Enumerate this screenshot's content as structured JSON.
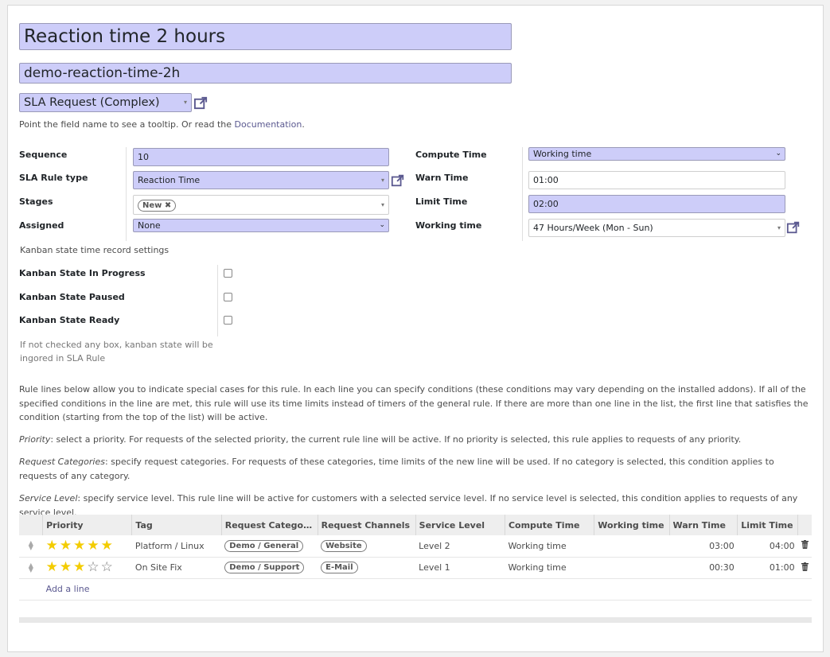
{
  "form": {
    "name": "Reaction time 2 hours",
    "code": "demo-reaction-time-2h",
    "sla_type": "SLA Request (Complex)",
    "hint_text": "Point the field name to see a tooltip. Or read the ",
    "hint_link": "Documentation",
    "hint_end": "."
  },
  "left": {
    "sequence_label": "Sequence",
    "sequence_value": "10",
    "rule_type_label": "SLA Rule type",
    "rule_type_value": "Reaction Time",
    "stages_label": "Stages",
    "stage_tag": "New",
    "assigned_label": "Assigned",
    "assigned_value": "None"
  },
  "right": {
    "compute_label": "Compute Time",
    "compute_value": "Working time",
    "warn_label": "Warn Time",
    "warn_value": "01:00",
    "limit_label": "Limit Time",
    "limit_value": "02:00",
    "working_label": "Working time",
    "working_value": "47 Hours/Week (Mon - Sun)"
  },
  "kanban": {
    "section_title": "Kanban state time record settings",
    "in_progress_label": "Kanban State In Progress",
    "paused_label": "Kanban State Paused",
    "ready_label": "Kanban State Ready",
    "note_line1": "If not checked any box, kanban state will be",
    "note_line2": "ingored in SLA Rule",
    "in_progress_checked": false,
    "paused_checked": false,
    "ready_checked": false
  },
  "help": {
    "p1": "Rule lines below allow you to indicate special cases for this rule. In each line you can specify conditions (these conditions may vary depending on the installed addons). If all of the specified conditions in the line are met, this rule will use its time limits instead of timers of the general rule. If there are more than one line in the list, the first line that satisfies the condition (starting from the top of the list) will be active.",
    "p2_term": "Priority",
    "p2_text": ": select a priority. For requests of the selected priority, the current rule line will be active. If no priority is selected, this rule applies to requests of any priority.",
    "p3_term": "Request Categories",
    "p3_text": ": specify request categories. For requests of these categories, time limits of the new line will be used. If no category is selected, this condition applies to requests of any category.",
    "p4_term": "Service Level",
    "p4_text": ": specify service level. This rule line will be active for customers with a selected service level. If no service level is selected, this condition applies to requests of any service level."
  },
  "table": {
    "headers": [
      "Priority",
      "Tag",
      "Request Catego…",
      "Request Channels",
      "Service Level",
      "Compute Time",
      "Working time",
      "Warn Time",
      "Limit Time"
    ],
    "rows": [
      {
        "priority": 5,
        "tag": "Platform / Linux",
        "category": "Demo / General",
        "channel": "Website",
        "service_level": "Level 2",
        "compute_time": "Working time",
        "working_time": "",
        "warn_time": "03:00",
        "limit_time": "04:00"
      },
      {
        "priority": 3,
        "tag": "On Site Fix",
        "category": "Demo / Support",
        "channel": "E-Mail",
        "service_level": "Level 1",
        "compute_time": "Working time",
        "working_time": "",
        "warn_time": "00:30",
        "limit_time": "01:00"
      }
    ],
    "add_line": "Add a line"
  },
  "colors": {
    "required_bg": "#cdcdf9",
    "star_on": "#f3cc00",
    "link": "#5b5990"
  },
  "icons": {
    "external_link": "external-link-icon",
    "trash": "trash-icon",
    "drag_handle": "drag-handle-icon",
    "star": "star-icon"
  }
}
